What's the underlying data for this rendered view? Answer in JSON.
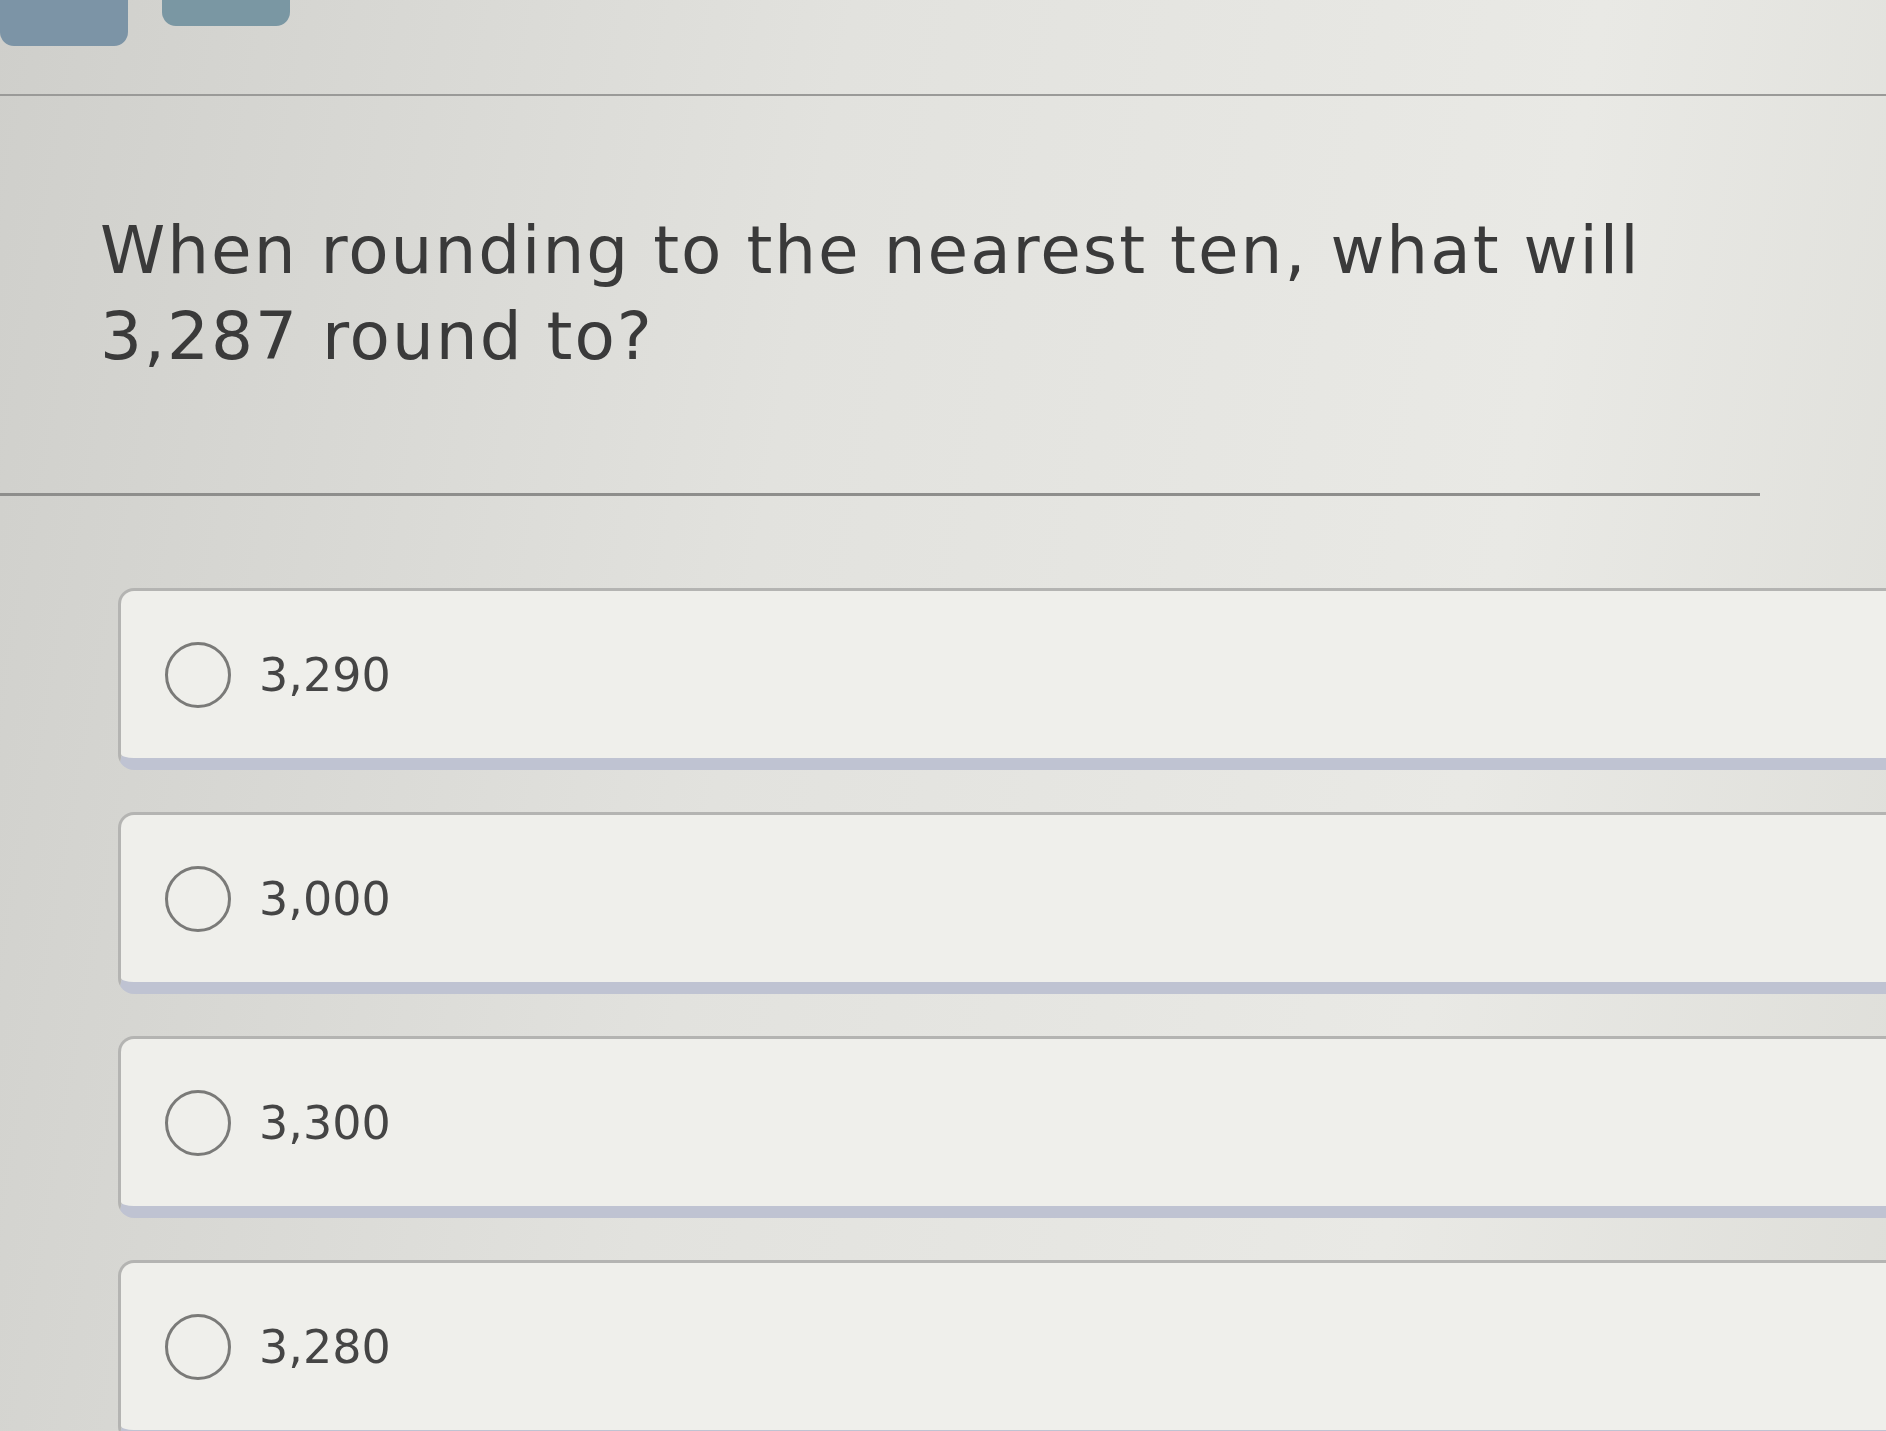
{
  "question": {
    "text": "When rounding to the nearest ten, what will 3,287 round to?"
  },
  "options": [
    {
      "label": "3,290",
      "selected": false
    },
    {
      "label": "3,000",
      "selected": false
    },
    {
      "label": "3,300",
      "selected": false
    },
    {
      "label": "3,280",
      "selected": false
    }
  ]
}
